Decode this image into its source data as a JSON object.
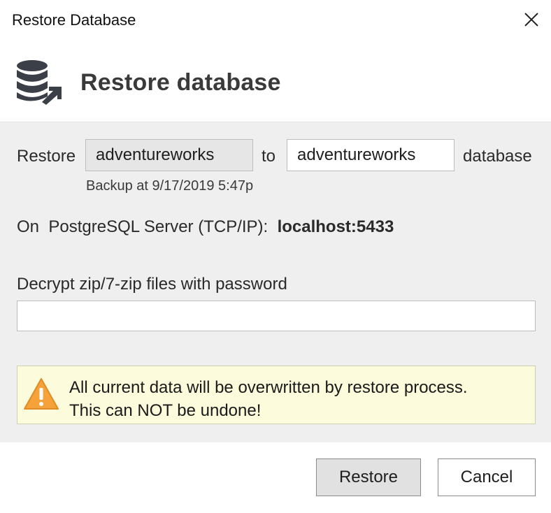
{
  "window": {
    "title": "Restore Database",
    "close_icon": "close-icon"
  },
  "header": {
    "title": "Restore database",
    "icon": "database-restore-icon"
  },
  "restore_row": {
    "restore_label": "Restore",
    "source_value": "adventureworks",
    "to_label": "to",
    "target_value": "adventureworks",
    "database_label": "database",
    "backup_note": "Backup at 9/17/2019 5:47p"
  },
  "server": {
    "label": "On  PostgreSQL Server (TCP/IP):",
    "value": "localhost:5433"
  },
  "password": {
    "label": "Decrypt zip/7-zip files with password",
    "value": ""
  },
  "warning": {
    "icon": "warning-icon",
    "line1": "All current data will be overwritten by restore process.",
    "line2": "This can NOT be undone!",
    "colors": {
      "background": "#fcfbdc",
      "icon": "#f5a23a"
    }
  },
  "buttons": {
    "restore": "Restore",
    "cancel": "Cancel"
  }
}
